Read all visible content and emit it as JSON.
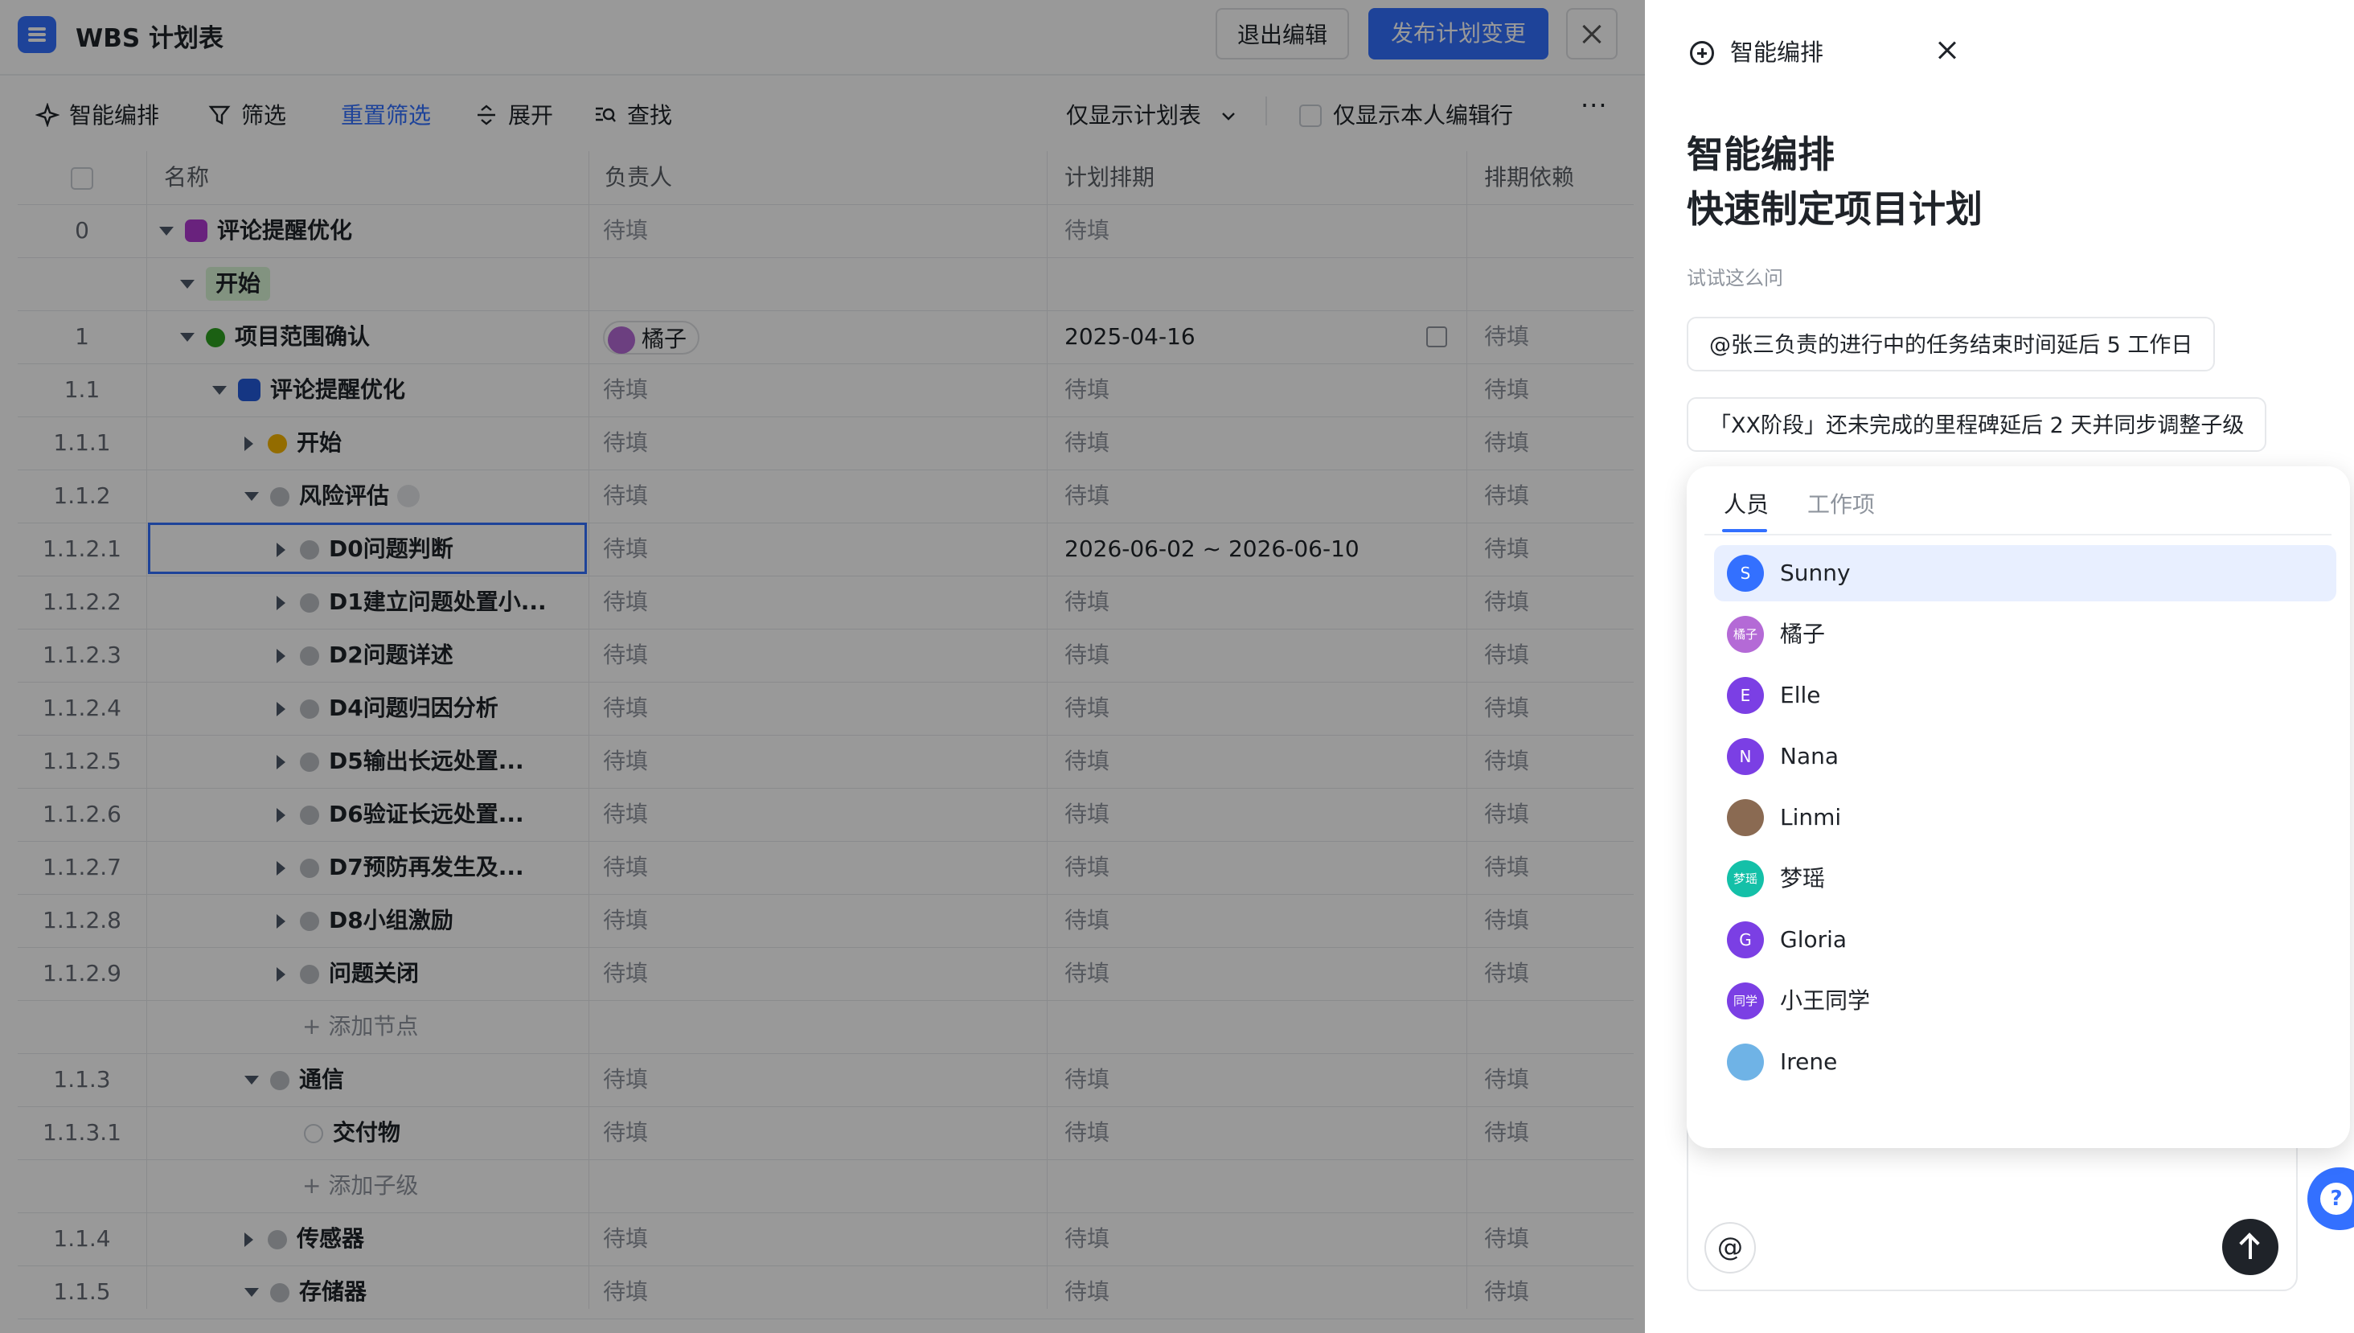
{
  "header": {
    "title": "WBS 计划表",
    "exit_edit": "退出编辑",
    "publish": "发布计划变更"
  },
  "toolbar": {
    "smart": "智能编排",
    "filter": "筛选",
    "reset_filter": "重置筛选",
    "expand": "展开",
    "find": "查找",
    "view_select": "仅显示计划表",
    "only_mine": "仅显示本人编辑行"
  },
  "table": {
    "columns": [
      "名称",
      "负责人",
      "计划排期",
      "排期依赖"
    ],
    "rows": [
      {
        "idx": "0",
        "name": "评论提醒优化",
        "owner": "待填",
        "date": "待填",
        "dep": ""
      },
      {
        "idx": "",
        "name": "开始",
        "owner": "",
        "date": "",
        "dep": ""
      },
      {
        "idx": "1",
        "name": "项目范围确认",
        "owner": "橘子",
        "date": "2025-04-16",
        "dep": "待填"
      },
      {
        "idx": "1.1",
        "name": "评论提醒优化",
        "owner": "待填",
        "date": "待填",
        "dep": "待填"
      },
      {
        "idx": "1.1.1",
        "name": "开始",
        "owner": "待填",
        "date": "待填",
        "dep": "待填"
      },
      {
        "idx": "1.1.2",
        "name": "风险评估",
        "owner": "待填",
        "date": "待填",
        "dep": "待填"
      },
      {
        "idx": "1.1.2.1",
        "name": "D0问题判断",
        "owner": "待填",
        "date": "2026-06-02 ~ 2026-06-10",
        "dep": "待填"
      },
      {
        "idx": "1.1.2.2",
        "name": "D1建立问题处置小...",
        "owner": "待填",
        "date": "待填",
        "dep": "待填"
      },
      {
        "idx": "1.1.2.3",
        "name": "D2问题详述",
        "owner": "待填",
        "date": "待填",
        "dep": "待填"
      },
      {
        "idx": "1.1.2.4",
        "name": "D4问题归因分析",
        "owner": "待填",
        "date": "待填",
        "dep": "待填"
      },
      {
        "idx": "1.1.2.5",
        "name": "D5输出长远处置...",
        "owner": "待填",
        "date": "待填",
        "dep": "待填"
      },
      {
        "idx": "1.1.2.6",
        "name": "D6验证长远处置...",
        "owner": "待填",
        "date": "待填",
        "dep": "待填"
      },
      {
        "idx": "1.1.2.7",
        "name": "D7预防再发生及...",
        "owner": "待填",
        "date": "待填",
        "dep": "待填"
      },
      {
        "idx": "1.1.2.8",
        "name": "D8小组激励",
        "owner": "待填",
        "date": "待填",
        "dep": "待填"
      },
      {
        "idx": "1.1.2.9",
        "name": "问题关闭",
        "owner": "待填",
        "date": "待填",
        "dep": "待填"
      },
      {
        "idx": "",
        "name": "+ 添加节点",
        "owner": "",
        "date": "",
        "dep": ""
      },
      {
        "idx": "1.1.3",
        "name": "通信",
        "owner": "待填",
        "date": "待填",
        "dep": "待填"
      },
      {
        "idx": "1.1.3.1",
        "name": "交付物",
        "owner": "待填",
        "date": "待填",
        "dep": "待填"
      },
      {
        "idx": "",
        "name": "+ 添加子级",
        "owner": "",
        "date": "",
        "dep": ""
      },
      {
        "idx": "1.1.4",
        "name": "传感器",
        "owner": "待填",
        "date": "待填",
        "dep": "待填"
      },
      {
        "idx": "1.1.5",
        "name": "存储器",
        "owner": "待填",
        "date": "待填",
        "dep": "待填"
      }
    ]
  },
  "panel": {
    "head": "智能编排",
    "hero_line1": "智能编排",
    "hero_line2": "快速制定项目计划",
    "try": "试试这么问",
    "suggestions": [
      "@张三负责的进行中的任务结束时间延后 5 工作日",
      "「XX阶段」还未完成的里程碑延后 2 天并同步调整子级"
    ],
    "input_value": "@",
    "at_symbol": "@"
  },
  "mention": {
    "tabs": [
      "人员",
      "工作项"
    ],
    "people": [
      {
        "name": "Sunny",
        "initial": "S",
        "color": "#3370ff"
      },
      {
        "name": "橘子",
        "initial": "橘子",
        "color": "#b46ad6"
      },
      {
        "name": "Elle",
        "initial": "E",
        "color": "#7b3fe4"
      },
      {
        "name": "Nana",
        "initial": "N",
        "color": "#7b3fe4"
      },
      {
        "name": "Linmi",
        "initial": "",
        "color": "#8a6a52"
      },
      {
        "name": "梦瑶",
        "initial": "梦瑶",
        "color": "#14c0a8"
      },
      {
        "name": "Gloria",
        "initial": "G",
        "color": "#7b3fe4"
      },
      {
        "name": "小王同学",
        "initial": "同学",
        "color": "#7b3fe4"
      },
      {
        "name": "Irene",
        "initial": "",
        "color": "#6fb3e6"
      }
    ]
  }
}
